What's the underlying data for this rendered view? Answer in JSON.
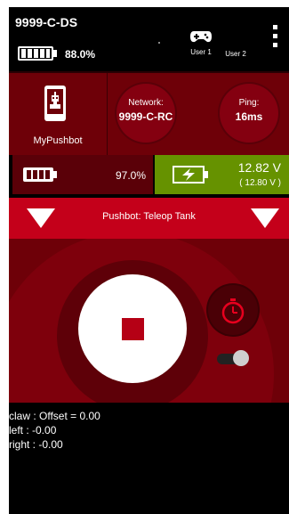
{
  "header": {
    "title": "9999-C-DS",
    "battery_percent": "88.0%",
    "users": [
      "User 1",
      "User 2"
    ]
  },
  "robot": {
    "name": "MyPushbot",
    "network_label": "Network:",
    "network_value": "9999-C-RC",
    "ping_label": "Ping:",
    "ping_value": "16ms"
  },
  "battery_row": {
    "rc_battery_percent": "97.0%",
    "voltage": "12.82 V",
    "voltage_min": "( 12.80 V )"
  },
  "opmode": {
    "name": "Pushbot: Teleop Tank"
  },
  "telemetry": {
    "lines": [
      "claw : Offset = 0.00",
      "left : -0.00",
      "right : -0.00"
    ]
  },
  "colors": {
    "dark_red": "#6e0008",
    "bright_red": "#c4001a",
    "green": "#669200"
  },
  "icons": [
    "battery-icon",
    "gamepad-icon",
    "overflow-menu-icon",
    "robot-phone-icon",
    "charging-battery-icon",
    "dropdown-triangle-icon",
    "stop-icon",
    "stopwatch-icon"
  ]
}
